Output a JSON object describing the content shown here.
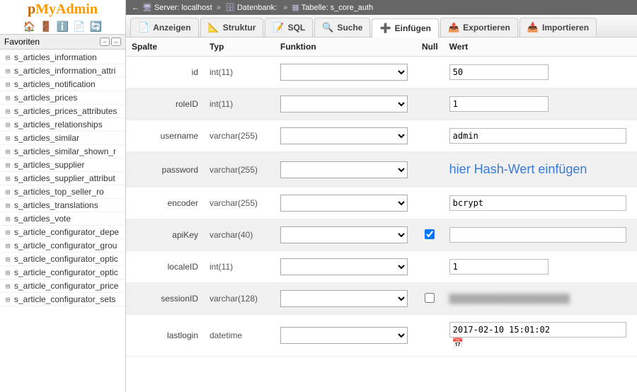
{
  "logo": {
    "part1": "p",
    "part2": "MyAdmin"
  },
  "favoriten_label": "Favoriten",
  "sidebar": {
    "items": [
      "s_articles_information",
      "s_articles_information_attri",
      "s_articles_notification",
      "s_articles_prices",
      "s_articles_prices_attributes",
      "s_articles_relationships",
      "s_articles_similar",
      "s_articles_similar_shown_r",
      "s_articles_supplier",
      "s_articles_supplier_attribut",
      "s_articles_top_seller_ro",
      "s_articles_translations",
      "s_articles_vote",
      "s_article_configurator_depe",
      "s_article_configurator_grou",
      "s_article_configurator_optic",
      "s_article_configurator_optic",
      "s_article_configurator_price",
      "s_article_configurator_sets"
    ]
  },
  "breadcrumb": {
    "server_label": "Server:",
    "server_value": "localhost",
    "db_label": "Datenbank:",
    "db_value": "",
    "table_label": "Tabelle:",
    "table_value": "s_core_auth"
  },
  "tabs": [
    {
      "label": "Anzeigen",
      "icon": "📄"
    },
    {
      "label": "Struktur",
      "icon": "📐"
    },
    {
      "label": "SQL",
      "icon": "📝"
    },
    {
      "label": "Suche",
      "icon": "🔍"
    },
    {
      "label": "Einfügen",
      "icon": "➕"
    },
    {
      "label": "Exportieren",
      "icon": "📤"
    },
    {
      "label": "Importieren",
      "icon": "📥"
    }
  ],
  "headers": {
    "spalte": "Spalte",
    "typ": "Typ",
    "funktion": "Funktion",
    "null": "Null",
    "wert": "Wert"
  },
  "rows": [
    {
      "name": "id",
      "type": "int(11)",
      "null_cb": false,
      "null_show": false,
      "value": "50",
      "wide": false,
      "kind": "input"
    },
    {
      "name": "roleID",
      "type": "int(11)",
      "null_cb": false,
      "null_show": false,
      "value": "1",
      "wide": false,
      "kind": "input"
    },
    {
      "name": "username",
      "type": "varchar(255)",
      "null_cb": false,
      "null_show": false,
      "value": "admin",
      "wide": true,
      "kind": "input"
    },
    {
      "name": "password",
      "type": "varchar(255)",
      "null_cb": false,
      "null_show": false,
      "value": "hier Hash-Wert einfügen",
      "wide": true,
      "kind": "placeholder"
    },
    {
      "name": "encoder",
      "type": "varchar(255)",
      "null_cb": false,
      "null_show": false,
      "value": "bcrypt",
      "wide": true,
      "kind": "input"
    },
    {
      "name": "apiKey",
      "type": "varchar(40)",
      "null_cb": true,
      "null_show": true,
      "value": "",
      "wide": true,
      "kind": "input"
    },
    {
      "name": "localeID",
      "type": "int(11)",
      "null_cb": false,
      "null_show": false,
      "value": "1",
      "wide": false,
      "kind": "input"
    },
    {
      "name": "sessionID",
      "type": "varchar(128)",
      "null_cb": false,
      "null_show": true,
      "value": "",
      "wide": true,
      "kind": "blur"
    },
    {
      "name": "lastlogin",
      "type": "datetime",
      "null_cb": false,
      "null_show": false,
      "value": "2017-02-10 15:01:02",
      "wide": true,
      "kind": "date"
    }
  ]
}
